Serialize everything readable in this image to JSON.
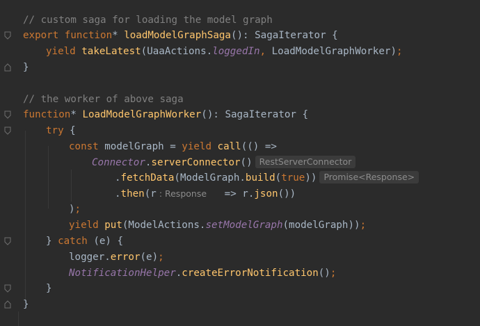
{
  "editor": {
    "lines": [
      {
        "id": "l1",
        "tokens": [
          {
            "c": "comment",
            "t": "// custom saga for loading the model graph"
          }
        ]
      },
      {
        "id": "l2",
        "tokens": [
          {
            "c": "kw",
            "t": "export function"
          },
          {
            "c": "plain",
            "t": "* "
          },
          {
            "c": "fn",
            "t": "loadModelGraphSaga"
          },
          {
            "c": "plain",
            "t": "(): SagaIterator {"
          }
        ]
      },
      {
        "id": "l3",
        "tokens": [
          {
            "c": "kw",
            "t": "yield "
          },
          {
            "c": "fn",
            "t": "takeLatest"
          },
          {
            "c": "plain",
            "t": "(UaaActions."
          },
          {
            "c": "static",
            "t": "loggedIn"
          },
          {
            "c": "kw",
            "t": ", "
          },
          {
            "c": "plain",
            "t": "LoadModelGraphWorker"
          },
          {
            "c": "plain",
            "t": ")"
          },
          {
            "c": "kw",
            "t": ";"
          }
        ]
      },
      {
        "id": "l4",
        "tokens": [
          {
            "c": "plain",
            "t": "}"
          }
        ]
      },
      {
        "id": "l5",
        "tokens": []
      },
      {
        "id": "l6",
        "tokens": [
          {
            "c": "comment",
            "t": "// the worker of above saga"
          }
        ]
      },
      {
        "id": "l7",
        "tokens": [
          {
            "c": "kw",
            "t": "function"
          },
          {
            "c": "plain",
            "t": "* "
          },
          {
            "c": "fn",
            "t": "LoadModelGraphWorker"
          },
          {
            "c": "plain",
            "t": "(): SagaIterator {"
          }
        ]
      },
      {
        "id": "l8",
        "tokens": [
          {
            "c": "kw",
            "t": "try "
          },
          {
            "c": "plain",
            "t": "{"
          }
        ]
      },
      {
        "id": "l9",
        "tokens": [
          {
            "c": "kw",
            "t": "const "
          },
          {
            "c": "plain",
            "t": "modelGraph = "
          },
          {
            "c": "kw",
            "t": "yield "
          },
          {
            "c": "fn",
            "t": "call"
          },
          {
            "c": "plain",
            "t": "(() =>"
          }
        ]
      },
      {
        "id": "l10",
        "tokens": [
          {
            "c": "static",
            "t": "Connector"
          },
          {
            "c": "plain",
            "t": "."
          },
          {
            "c": "fn",
            "t": "serverConnector"
          },
          {
            "c": "plain",
            "t": "()"
          },
          {
            "c": "hint",
            "t": "RestServerConnector"
          }
        ]
      },
      {
        "id": "l11",
        "tokens": [
          {
            "c": "plain",
            "t": "."
          },
          {
            "c": "fn",
            "t": "fetchData"
          },
          {
            "c": "plain",
            "t": "(ModelGraph."
          },
          {
            "c": "fn",
            "t": "build"
          },
          {
            "c": "plain",
            "t": "("
          },
          {
            "c": "kw",
            "t": "true"
          },
          {
            "c": "plain",
            "t": "))"
          },
          {
            "c": "hint",
            "t": "Promise<Response>"
          }
        ]
      },
      {
        "id": "l12",
        "tokens": [
          {
            "c": "plain",
            "t": "."
          },
          {
            "c": "fn",
            "t": "then"
          },
          {
            "c": "plain",
            "t": "(r"
          },
          {
            "c": "inhint",
            "t": ": Response"
          },
          {
            "c": "plain",
            "t": "   => r."
          },
          {
            "c": "fn",
            "t": "json"
          },
          {
            "c": "plain",
            "t": "())"
          }
        ]
      },
      {
        "id": "l13",
        "tokens": [
          {
            "c": "plain",
            "t": ")"
          },
          {
            "c": "kw",
            "t": ";"
          }
        ]
      },
      {
        "id": "l14",
        "tokens": [
          {
            "c": "kw",
            "t": "yield "
          },
          {
            "c": "fn",
            "t": "put"
          },
          {
            "c": "plain",
            "t": "(ModelActions."
          },
          {
            "c": "static",
            "t": "setModelGraph"
          },
          {
            "c": "plain",
            "t": "(modelGraph))"
          },
          {
            "c": "kw",
            "t": ";"
          }
        ]
      },
      {
        "id": "l15",
        "tokens": [
          {
            "c": "plain",
            "t": "} "
          },
          {
            "c": "kw",
            "t": "catch "
          },
          {
            "c": "plain",
            "t": "(e) {"
          }
        ]
      },
      {
        "id": "l16",
        "tokens": [
          {
            "c": "plain",
            "t": "logger."
          },
          {
            "c": "fn",
            "t": "error"
          },
          {
            "c": "plain",
            "t": "(e)"
          },
          {
            "c": "kw",
            "t": ";"
          }
        ]
      },
      {
        "id": "l17",
        "tokens": [
          {
            "c": "static",
            "t": "NotificationHelper"
          },
          {
            "c": "plain",
            "t": "."
          },
          {
            "c": "fn",
            "t": "createErrorNotification"
          },
          {
            "c": "plain",
            "t": "()"
          },
          {
            "c": "kw",
            "t": ";"
          }
        ]
      },
      {
        "id": "l18",
        "tokens": [
          {
            "c": "plain",
            "t": "}"
          }
        ]
      },
      {
        "id": "l19",
        "tokens": [
          {
            "c": "plain",
            "t": "}"
          }
        ]
      }
    ]
  },
  "colors": {
    "background": "#2b2b2b",
    "keyword": "#cc7832",
    "function": "#ffc66d",
    "comment": "#808080",
    "static": "#9876aa",
    "text": "#a9b7c6"
  }
}
